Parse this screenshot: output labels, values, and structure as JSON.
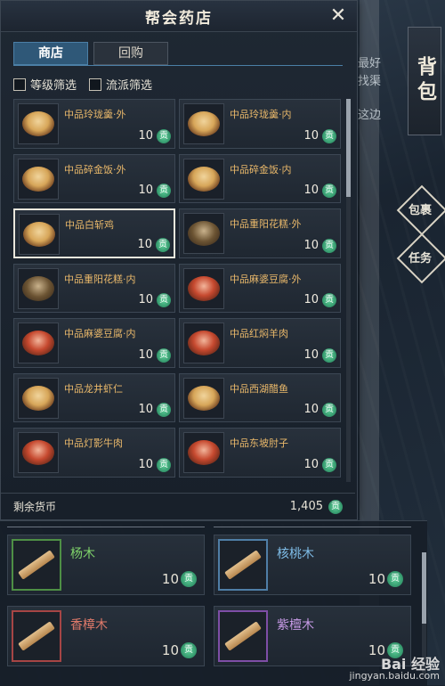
{
  "shop": {
    "title": "帮会药店",
    "tabs": [
      "商店",
      "回购"
    ],
    "active_tab": 0,
    "filters": [
      "等级筛选",
      "流派筛选"
    ],
    "currency_icon": "贡",
    "items": [
      {
        "name": "中品玲珑羹·外",
        "price": "10",
        "style": "gold",
        "selected": false
      },
      {
        "name": "中品玲珑羹·内",
        "price": "10",
        "style": "gold",
        "selected": false
      },
      {
        "name": "中品碎金饭·外",
        "price": "10",
        "style": "gold",
        "selected": false
      },
      {
        "name": "中品碎金饭·内",
        "price": "10",
        "style": "gold",
        "selected": false
      },
      {
        "name": "中品白斩鸡",
        "price": "10",
        "style": "gold",
        "selected": true
      },
      {
        "name": "中品重阳花糕·外",
        "price": "10",
        "style": "dark",
        "selected": false
      },
      {
        "name": "中品重阳花糕·内",
        "price": "10",
        "style": "dark",
        "selected": false
      },
      {
        "name": "中品麻婆豆腐·外",
        "price": "10",
        "style": "red",
        "selected": false
      },
      {
        "name": "中品麻婆豆腐·内",
        "price": "10",
        "style": "red",
        "selected": false
      },
      {
        "name": "中品红焖羊肉",
        "price": "10",
        "style": "red",
        "selected": false
      },
      {
        "name": "中品龙井虾仁",
        "price": "10",
        "style": "gold",
        "selected": false
      },
      {
        "name": "中品西湖醋鱼",
        "price": "10",
        "style": "gold",
        "selected": false
      },
      {
        "name": "中品灯影牛肉",
        "price": "10",
        "style": "red",
        "selected": false
      },
      {
        "name": "中品东坡肘子",
        "price": "10",
        "style": "red",
        "selected": false
      }
    ],
    "footer": {
      "label": "剩余货币",
      "amount": "1,405"
    }
  },
  "side": {
    "backpack": "背包",
    "bag_button": "包裹",
    "quest_button": "任务",
    "behind_texts": [
      "最好",
      "找渠",
      "这边"
    ]
  },
  "bag": {
    "items": [
      {
        "name": "杨木",
        "price": "10",
        "frame_color": "#4e8f45",
        "name_color": "#7fd36a"
      },
      {
        "name": "核桃木",
        "price": "10",
        "frame_color": "#4f7ea6",
        "name_color": "#7fbde8"
      },
      {
        "name": "香樟木",
        "price": "10",
        "frame_color": "#a64545",
        "name_color": "#e07a6a"
      },
      {
        "name": "紫檀木",
        "price": "10",
        "frame_color": "#7e4ea6",
        "name_color": "#c79ae6"
      }
    ]
  },
  "watermark": {
    "line1": "Bai 经验",
    "line2": "jingyan.baidu.com"
  }
}
